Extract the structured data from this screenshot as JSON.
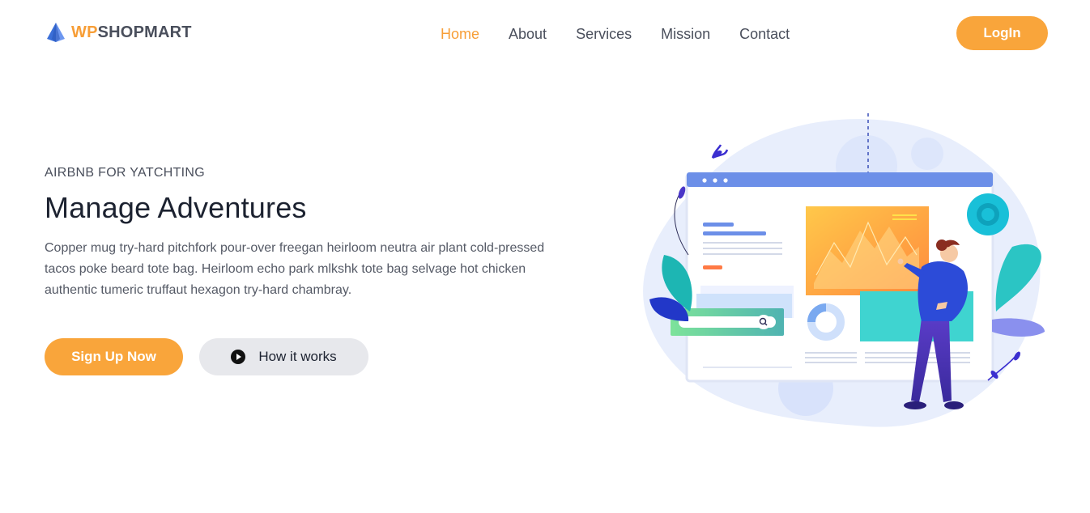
{
  "brand": {
    "name_accent": "WP",
    "name_rest": "SHOPMART",
    "accent_color": "#f79e37",
    "icon": "pyramid-logo-icon"
  },
  "nav": {
    "items": [
      {
        "label": "Home",
        "active": true
      },
      {
        "label": "About",
        "active": false
      },
      {
        "label": "Services",
        "active": false
      },
      {
        "label": "Mission",
        "active": false
      },
      {
        "label": "Contact",
        "active": false
      }
    ],
    "login_label": "LogIn"
  },
  "hero": {
    "eyebrow": "AIRBNB FOR YATCHTING",
    "title": "Manage Adventures",
    "description": "Copper mug try-hard pitchfork pour-over freegan heirloom neutra air plant cold-pressed tacos poke beard tote bag. Heirloom echo park mlkshk tote bag selvage hot chicken authentic tumeric truffaut hexagon try-hard chambray.",
    "primary_cta": "Sign Up Now",
    "secondary_cta": "How it works",
    "secondary_icon": "play-circle-icon"
  },
  "colors": {
    "primary": "#f9a53b",
    "secondary_bg": "#e7e8ec",
    "illustration_blue": "#6c8fe8",
    "illustration_teal": "#3ccfcf"
  }
}
